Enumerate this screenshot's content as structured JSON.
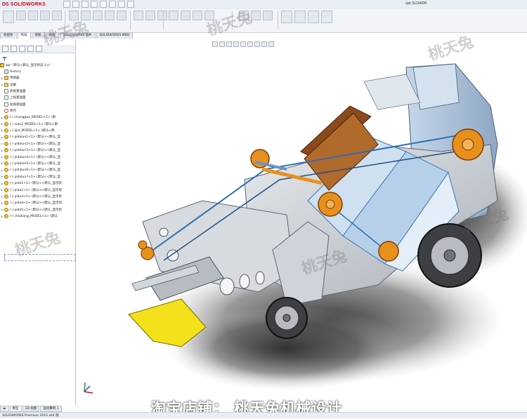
{
  "app": {
    "brand_ds": "DS",
    "brand_name": "SOLIDWORKS",
    "doc_title": "zpt.SLDASM"
  },
  "tabs": [
    "装配体",
    "布局",
    "草图",
    "评估",
    "SOLIDWORKS 插件",
    "SOLIDWORKS MBD"
  ],
  "tree": {
    "root": "zpt（默认<默认_显示状态-1>）",
    "items": [
      {
        "label": "History",
        "icon": "history-icon"
      },
      {
        "label": "传感器",
        "icon": "sensor-icon"
      },
      {
        "label": "注解",
        "icon": "annotation-icon"
      },
      {
        "label": "前视基准面",
        "icon": "plane-icon"
      },
      {
        "label": "上视基准面",
        "icon": "plane-icon"
      },
      {
        "label": "右视基准面",
        "icon": "plane-icon"
      },
      {
        "label": "原点",
        "icon": "origin-icon"
      },
      {
        "label": "(-) changgao_MODEL<1> (默",
        "icon": "part-icon"
      },
      {
        "label": "(-) xian2_MODEL<1> (默认<默",
        "icon": "part-icon"
      },
      {
        "label": "(-) jijia_MODEL<1> (默认<默",
        "icon": "part-icon"
      },
      {
        "label": "(-) pidalun1<1> (默认<<默认_显",
        "icon": "part-icon"
      },
      {
        "label": "(-) pidalun2<1> (默认<<默认_显",
        "icon": "part-icon"
      },
      {
        "label": "(-) pidalun3<1> (默认<<默认_显",
        "icon": "part-icon"
      },
      {
        "label": "(-) pidalun4<1> (默认<<默认_显",
        "icon": "part-icon"
      },
      {
        "label": "(-) pidalun5<1> (默认<<默认_显",
        "icon": "part-icon"
      },
      {
        "label": "(-) pidalun6<1> (默认<<默认_显",
        "icon": "part-icon"
      },
      {
        "label": "(-) pidalun7<1> (默认<<默认_显",
        "icon": "part-icon"
      },
      {
        "label": "(-) pida1<1> (默认<<默认_显示状",
        "icon": "part-icon"
      },
      {
        "label": "(-) pida2<1> (默认<<默认_显示状",
        "icon": "part-icon"
      },
      {
        "label": "(-) pida3<1> (默认<<默认_显示状",
        "icon": "part-icon"
      },
      {
        "label": "(-) pida4<1> (默认<<默认_显示状",
        "icon": "part-icon"
      },
      {
        "label": "(-) pida5<1> (默认<<默认_显示状",
        "icon": "part-icon"
      },
      {
        "label": "(-) chailiang_MODEL<1> (默认",
        "icon": "part-icon"
      }
    ]
  },
  "bottom_tabs": [
    "模型",
    "3D 视图",
    "运动算例 1"
  ],
  "status": "SOLIDWORKS Premium 2016 x64 版",
  "watermark": "桃天兔",
  "shop": "淘宝店铺：   桃天兔机械设计",
  "colors": {
    "accent_red": "#d0021b",
    "frame_gray": "#c7ccd2",
    "pulley_orange": "#e8901e",
    "plate_yellow": "#f3e11c",
    "belt_blue": "#4a90c8"
  }
}
